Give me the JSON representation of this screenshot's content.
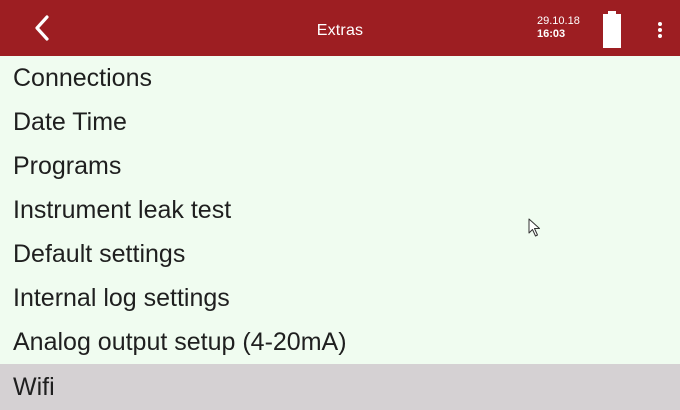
{
  "header": {
    "title": "Extras",
    "back_icon": "chevron-left-icon",
    "date": "29.10.18",
    "time": "16:03",
    "battery_icon": "battery-full-icon",
    "menu_icon": "more-vertical-icon",
    "bg_color": "#9d1e22"
  },
  "menu": {
    "bg_color": "#f0fcf0",
    "selected_color": "#d5d1d3",
    "items": [
      {
        "label": "Connections",
        "selected": false
      },
      {
        "label": "Date Time",
        "selected": false
      },
      {
        "label": "Programs",
        "selected": false
      },
      {
        "label": "Instrument leak test",
        "selected": false
      },
      {
        "label": "Default settings",
        "selected": false
      },
      {
        "label": "Internal log settings",
        "selected": false
      },
      {
        "label": "Analog output setup (4-20mA)",
        "selected": false
      },
      {
        "label": "Wifi",
        "selected": true
      }
    ]
  },
  "pointer": {
    "icon": "mouse-pointer-icon"
  }
}
